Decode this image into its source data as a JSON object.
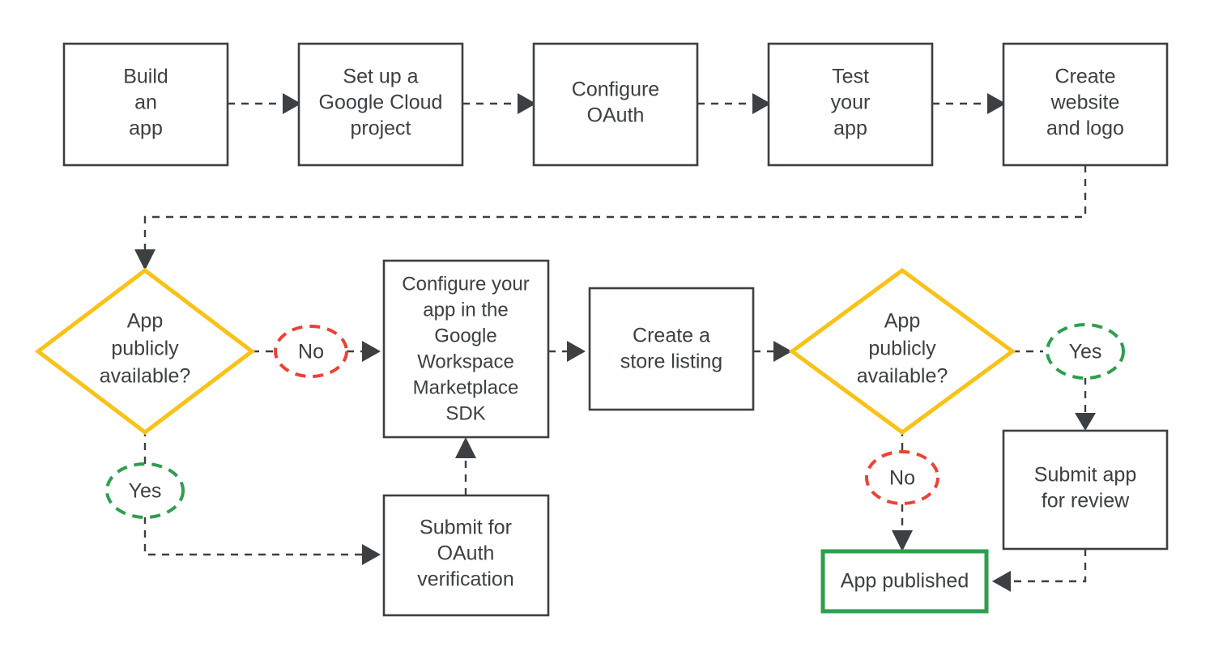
{
  "diagram": {
    "title": "Google Workspace Marketplace app publishing flow",
    "background_color": "#FFFFFF",
    "colors": {
      "node_border": "#3C4043",
      "node_text": "#3C4043",
      "decision_border": "#F9C218",
      "yes_badge_border": "#2E9E4F",
      "no_badge_border": "#EA4335",
      "published_border": "#2E9E4F",
      "edge": "#3C4043"
    },
    "nodes": [
      {
        "id": "build-an-app",
        "shape": "rect",
        "lines": [
          "Build",
          "an",
          "app"
        ]
      },
      {
        "id": "set-up-gcp-project",
        "shape": "rect",
        "lines": [
          "Set up a",
          "Google Cloud",
          "project"
        ]
      },
      {
        "id": "configure-oauth",
        "shape": "rect",
        "lines": [
          "Configure",
          "OAuth"
        ]
      },
      {
        "id": "test-your-app",
        "shape": "rect",
        "lines": [
          "Test",
          "your",
          "app"
        ]
      },
      {
        "id": "create-website-and-logo",
        "shape": "rect",
        "lines": [
          "Create",
          "website",
          "and logo"
        ]
      },
      {
        "id": "decision-public-left",
        "shape": "diamond",
        "lines": [
          "App",
          "publicly",
          "available?"
        ]
      },
      {
        "id": "configure-app-sdk",
        "shape": "rect",
        "lines": [
          "Configure your",
          "app in the",
          "Google",
          "Workspace",
          "Marketplace",
          "SDK"
        ]
      },
      {
        "id": "create-store-listing",
        "shape": "rect",
        "lines": [
          "Create a",
          "store listing"
        ]
      },
      {
        "id": "decision-public-right",
        "shape": "diamond",
        "lines": [
          "App",
          "publicly",
          "available?"
        ]
      },
      {
        "id": "submit-oauth-verification",
        "shape": "rect",
        "lines": [
          "Submit for",
          "OAuth",
          "verification"
        ]
      },
      {
        "id": "submit-app-for-review",
        "shape": "rect",
        "lines": [
          "Submit app",
          "for review"
        ]
      },
      {
        "id": "app-published",
        "shape": "rect",
        "lines": [
          "App published"
        ],
        "accent": "green"
      }
    ],
    "badges": [
      {
        "id": "badge-no-left",
        "label": "No",
        "tone": "no"
      },
      {
        "id": "badge-yes-left",
        "label": "Yes",
        "tone": "yes"
      },
      {
        "id": "badge-yes-right",
        "label": "Yes",
        "tone": "yes"
      },
      {
        "id": "badge-no-right",
        "label": "No",
        "tone": "no"
      }
    ],
    "edges": [
      {
        "from": "build-an-app",
        "to": "set-up-gcp-project"
      },
      {
        "from": "set-up-gcp-project",
        "to": "configure-oauth"
      },
      {
        "from": "configure-oauth",
        "to": "test-your-app"
      },
      {
        "from": "test-your-app",
        "to": "create-website-and-logo"
      },
      {
        "from": "create-website-and-logo",
        "to": "decision-public-left"
      },
      {
        "from": "decision-public-left",
        "to": "configure-app-sdk",
        "label": "No"
      },
      {
        "from": "decision-public-left",
        "to": "submit-oauth-verification",
        "label": "Yes"
      },
      {
        "from": "submit-oauth-verification",
        "to": "configure-app-sdk"
      },
      {
        "from": "configure-app-sdk",
        "to": "create-store-listing"
      },
      {
        "from": "create-store-listing",
        "to": "decision-public-right"
      },
      {
        "from": "decision-public-right",
        "to": "submit-app-for-review",
        "label": "Yes"
      },
      {
        "from": "decision-public-right",
        "to": "app-published",
        "label": "No"
      },
      {
        "from": "submit-app-for-review",
        "to": "app-published"
      }
    ]
  },
  "labels": {
    "build_an_app_l1": "Build",
    "build_an_app_l2": "an",
    "build_an_app_l3": "app",
    "gcp_l1": "Set up a",
    "gcp_l2": "Google Cloud",
    "gcp_l3": "project",
    "oauth_l1": "Configure",
    "oauth_l2": "OAuth",
    "test_l1": "Test",
    "test_l2": "your",
    "test_l3": "app",
    "website_l1": "Create",
    "website_l2": "website",
    "website_l3": "and logo",
    "dec_left_l1": "App",
    "dec_left_l2": "publicly",
    "dec_left_l3": "available?",
    "sdk_l1": "Configure your",
    "sdk_l2": "app in the",
    "sdk_l3": "Google",
    "sdk_l4": "Workspace",
    "sdk_l5": "Marketplace",
    "sdk_l6": "SDK",
    "listing_l1": "Create a",
    "listing_l2": "store listing",
    "dec_right_l1": "App",
    "dec_right_l2": "publicly",
    "dec_right_l3": "available?",
    "verify_l1": "Submit for",
    "verify_l2": "OAuth",
    "verify_l3": "verification",
    "review_l1": "Submit app",
    "review_l2": "for review",
    "published_l1": "App published",
    "badge_no_left": "No",
    "badge_yes_left": "Yes",
    "badge_yes_right": "Yes",
    "badge_no_right": "No"
  }
}
